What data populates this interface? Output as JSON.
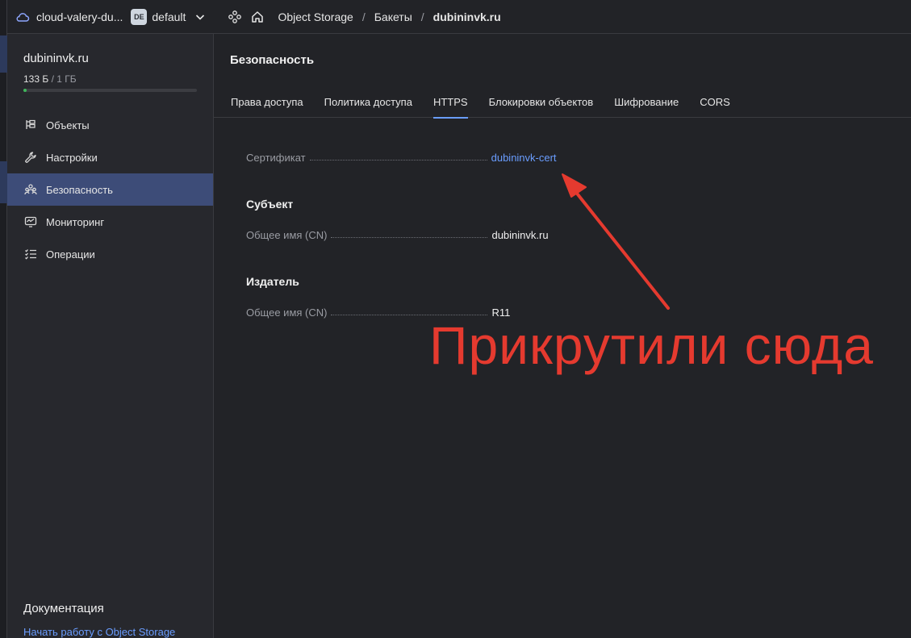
{
  "topbar": {
    "cloud_name": "cloud-valery-du...",
    "folder_badge": "DE",
    "folder_name": "default",
    "breadcrumbs": [
      "Object Storage",
      "Бакеты",
      "dubininvk.ru"
    ],
    "icons": [
      "cloud-icon",
      "chevron-down-icon",
      "services-icon",
      "home-icon"
    ]
  },
  "sidebar": {
    "bucket_name": "dubininvk.ru",
    "usage_used": "133 Б",
    "usage_total": "/ 1 ГБ",
    "usage_fraction": 0.02,
    "items": [
      {
        "label": "Объекты",
        "icon": "objects-icon",
        "active": false
      },
      {
        "label": "Настройки",
        "icon": "wrench-icon",
        "active": false
      },
      {
        "label": "Безопасность",
        "icon": "users-icon",
        "active": true
      },
      {
        "label": "Мониторинг",
        "icon": "monitor-icon",
        "active": false
      },
      {
        "label": "Операции",
        "icon": "list-check-icon",
        "active": false
      }
    ],
    "docs_title": "Документация",
    "docs_link": "Начать работу с Object Storage"
  },
  "main": {
    "title": "Безопасность",
    "tabs": [
      {
        "label": "Права доступа",
        "active": false
      },
      {
        "label": "Политика доступа",
        "active": false
      },
      {
        "label": "HTTPS",
        "active": true
      },
      {
        "label": "Блокировки объектов",
        "active": false
      },
      {
        "label": "Шифрование",
        "active": false
      },
      {
        "label": "CORS",
        "active": false
      }
    ],
    "certificate_label": "Сертификат",
    "certificate_value": "dubininvk-cert",
    "subject_title": "Субъект",
    "subject_cn_label": "Общее имя (CN)",
    "subject_cn_value": "dubininvk.ru",
    "issuer_title": "Издатель",
    "issuer_cn_label": "Общее имя (CN)",
    "issuer_cn_value": "R11"
  },
  "annotation": {
    "text": "Прикрутили сюда",
    "color": "#e53a2f"
  },
  "colors": {
    "accent": "#6a9dff",
    "active_item_bg": "#3d4c78",
    "usage_fill": "#3fb65a",
    "background": "#222327"
  }
}
